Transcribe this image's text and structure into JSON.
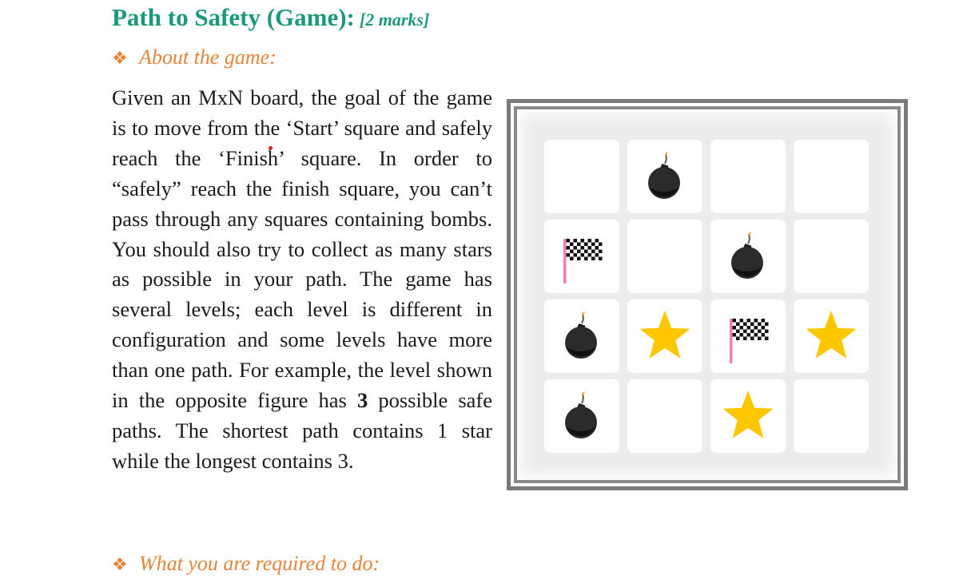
{
  "heading": {
    "title": "Path to Safety (Game):",
    "marks": "[2 marks]"
  },
  "about": {
    "bullet": "❖",
    "label": "About the game:"
  },
  "paragraph": {
    "before_bold": "Given an MxN board, the goal of the game is to move from the ‘Start’ square and safely reach the ‘Finish’ square. In order to “safely” reach the finish square, you can’t pass through any squares containing bombs. You should also try to collect as many stars as possible in your path. The game has several levels; each level is different in configuration and some levels have more than one path. For example, the level shown in the opposite figure has",
    "bold": "3",
    "after_bold": "possible safe paths. The shortest path contains 1 star while the longest contains 3."
  },
  "next_section": {
    "bullet": "❖",
    "label": "What you are required to do:"
  },
  "board": {
    "rows": 4,
    "cols": 4,
    "cells": [
      [
        "empty",
        "bomb",
        "empty",
        "empty"
      ],
      [
        "flag",
        "empty",
        "bomb",
        "empty"
      ],
      [
        "bomb",
        "star",
        "flag",
        "star"
      ],
      [
        "bomb",
        "empty",
        "star",
        "empty"
      ]
    ],
    "colors": {
      "star": "#ffc700",
      "bomb": "#2b2b2b",
      "flag_pole": "#f080a8"
    }
  }
}
